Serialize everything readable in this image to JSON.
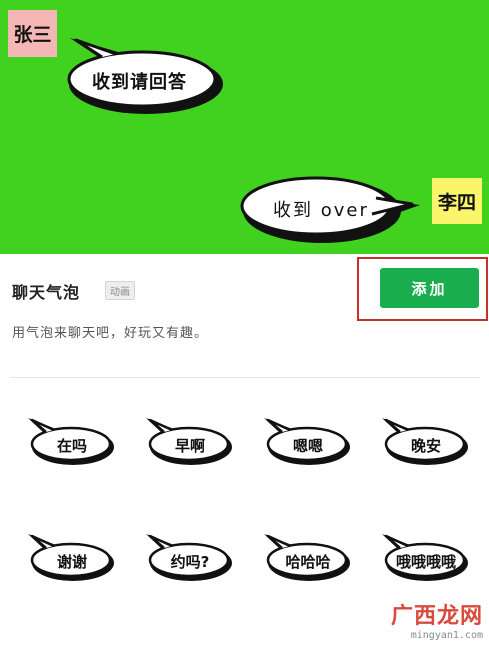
{
  "preview": {
    "sender_name": "张三",
    "sender_message": "收到请回答",
    "receiver_name": "李四",
    "receiver_message": "收到 over",
    "background_color": "#41d11f"
  },
  "header": {
    "title": "聊天气泡",
    "badge": "动画",
    "add_button": "添加",
    "description": "用气泡来聊天吧，好玩又有趣。"
  },
  "stickers": [
    {
      "label": "在吗"
    },
    {
      "label": "早啊"
    },
    {
      "label": "嗯嗯"
    },
    {
      "label": "晚安"
    },
    {
      "label": "谢谢"
    },
    {
      "label": "约吗?"
    },
    {
      "label": "哈哈哈"
    },
    {
      "label": "哦哦哦哦"
    }
  ],
  "watermark": {
    "brand": "广西龙网",
    "url": "mingyan1.com"
  }
}
